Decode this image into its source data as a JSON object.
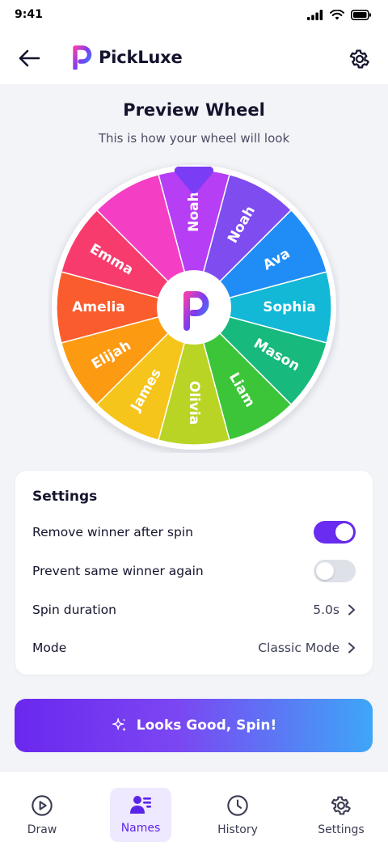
{
  "status_bar": {
    "time": "9:41"
  },
  "header": {
    "app_name": "PickLuxe"
  },
  "preview": {
    "title": "Preview Wheel",
    "subtitle": "This is how your wheel will look"
  },
  "wheel": {
    "segments": [
      {
        "name": "Noah",
        "color": "#b63ef5"
      },
      {
        "name": "Noah",
        "color": "#7f4cf0"
      },
      {
        "name": "Ava",
        "color": "#1f8df5"
      },
      {
        "name": "Sophia",
        "color": "#12b8d6"
      },
      {
        "name": "Mason",
        "color": "#17b97c"
      },
      {
        "name": "Liam",
        "color": "#3dc53a"
      },
      {
        "name": "Olivia",
        "color": "#b9d424"
      },
      {
        "name": "James",
        "color": "#f6c51b"
      },
      {
        "name": "Elijah",
        "color": "#fc9a12"
      },
      {
        "name": "Amelia",
        "color": "#fa5c2e"
      },
      {
        "name": "Emma",
        "color": "#f73c6d"
      },
      {
        "name": "",
        "color": "#f43ec4"
      }
    ]
  },
  "settings": {
    "title": "Settings",
    "remove_winner": {
      "label": "Remove winner after spin",
      "on": true
    },
    "prevent_same": {
      "label": "Prevent same winner again",
      "on": false
    },
    "spin_duration": {
      "label": "Spin duration",
      "value": "5.0s"
    },
    "mode": {
      "label": "Mode",
      "value": "Classic Mode"
    }
  },
  "spin_button": {
    "label": "Looks Good, Spin!"
  },
  "nav": {
    "items": [
      {
        "label": "Draw"
      },
      {
        "label": "Names"
      },
      {
        "label": "History"
      },
      {
        "label": "Settings"
      }
    ]
  },
  "colors": {
    "accent": "#6a2cf0",
    "pointer": "#7b3cf5"
  }
}
